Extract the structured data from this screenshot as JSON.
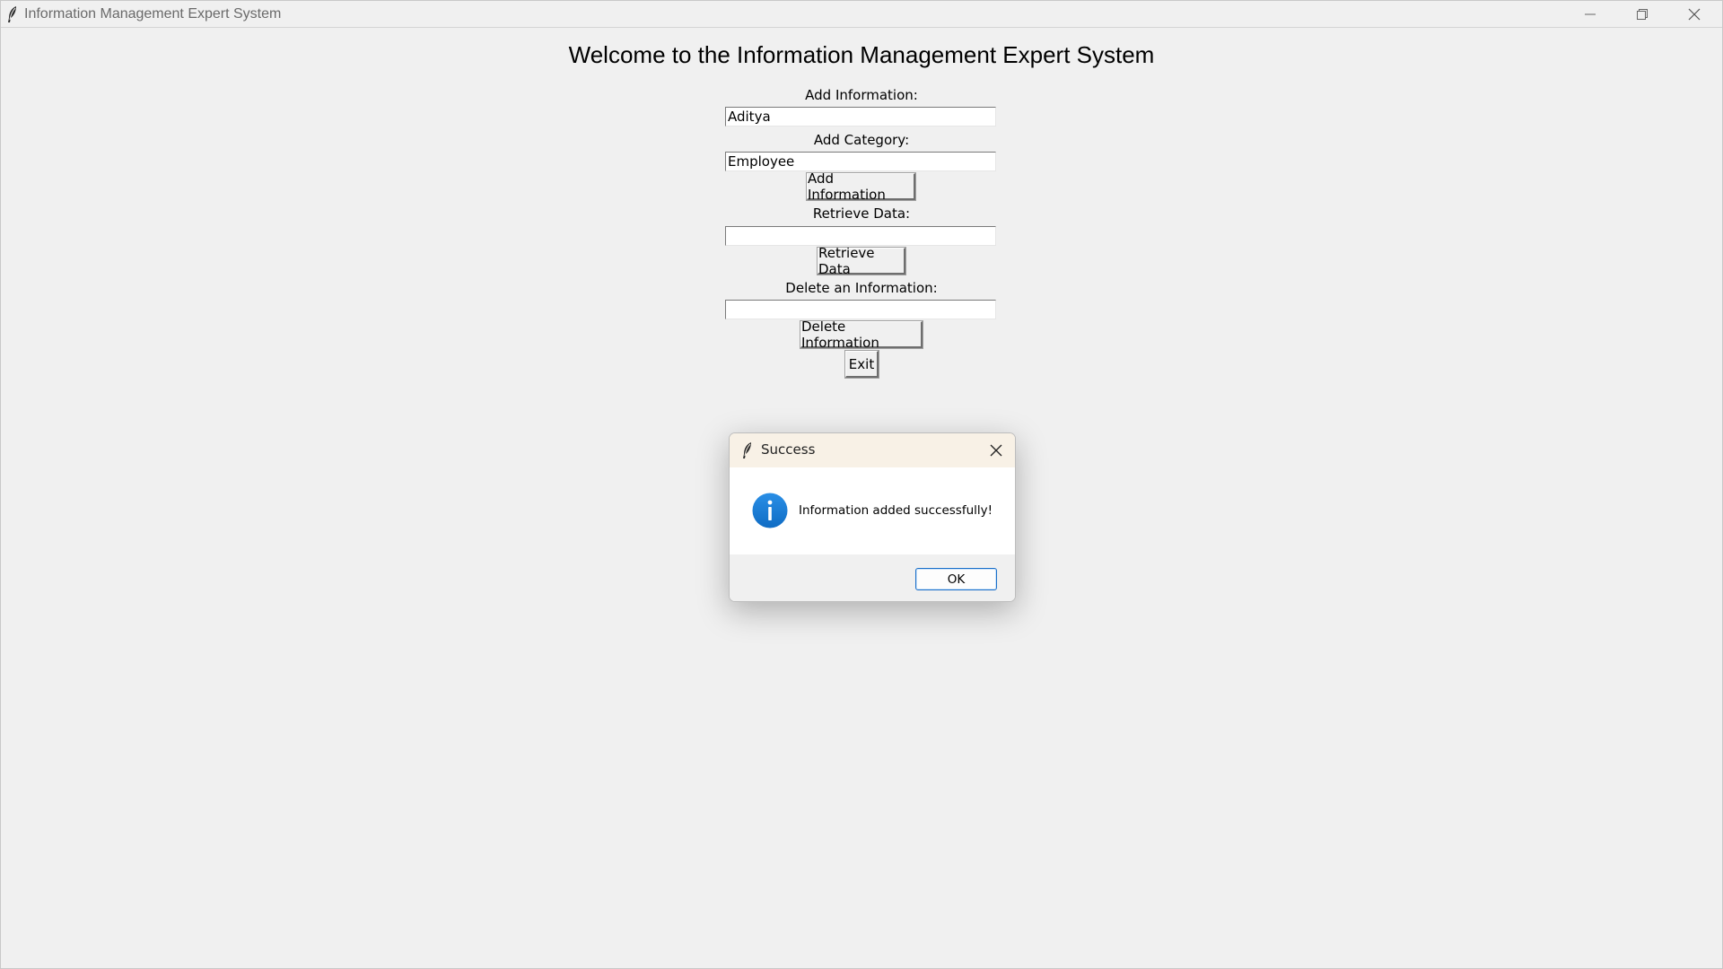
{
  "window": {
    "title": "Information Management Expert System",
    "controls": {
      "minimize_icon": "minimize-icon",
      "restore_icon": "restore-icon",
      "close_icon": "close-icon"
    }
  },
  "main": {
    "heading": "Welcome to the Information Management Expert System",
    "add_info_label": "Add Information:",
    "add_info_value": "Aditya",
    "add_category_label": "Add Category:",
    "add_category_value": "Employee",
    "add_button": "Add Information",
    "retrieve_label": "Retrieve Data:",
    "retrieve_value": "",
    "retrieve_button": "Retrieve Data",
    "delete_label": "Delete an Information:",
    "delete_value": "",
    "delete_button": "Delete Information",
    "exit_button": "Exit"
  },
  "dialog": {
    "title": "Success",
    "message": "Information added successfully!",
    "ok_button": "OK",
    "icon": "info-icon",
    "accent": "#1a7fd8"
  }
}
